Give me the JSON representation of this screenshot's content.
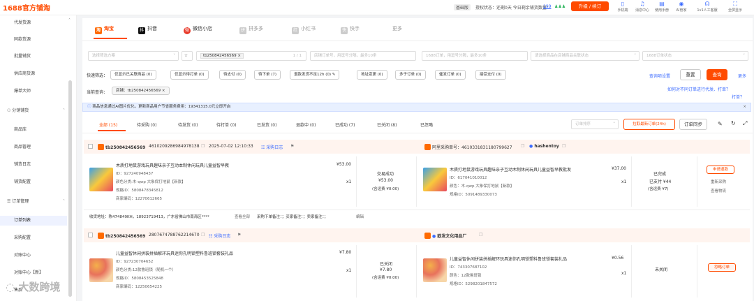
{
  "app": {
    "logo": "1688官方铺淘",
    "version": "基础版",
    "auth_status": "授权状态：还剩0天  今日剩余铺货数量：",
    "auth_count": "199",
    "upgrade": "升级 / 续订"
  },
  "top_icons": [
    "手机端",
    "消息中心",
    "使用手册",
    "AI管家",
    "1v1人工客服",
    "全屏显示"
  ],
  "sidebar": {
    "items": [
      {
        "label": "代发货源",
        "group": false
      },
      {
        "label": "同款货源",
        "group": false
      },
      {
        "label": "批量铺货",
        "group": false
      },
      {
        "label": "供应商货源",
        "group": false
      },
      {
        "label": "爆单大师",
        "group": false
      },
      {
        "label": "分销铺货",
        "group": true
      },
      {
        "label": "商品库",
        "group": false
      },
      {
        "label": "商品管理",
        "group": false
      },
      {
        "label": "铺货日志",
        "group": false
      },
      {
        "label": "铺货配置",
        "group": false
      },
      {
        "label": "订单管理",
        "group": true
      },
      {
        "label": "订单列表",
        "group": false
      },
      {
        "label": "采购配置",
        "group": false
      },
      {
        "label": "对账中心",
        "group": false
      },
      {
        "label": "对账中心【新】",
        "group": false
      },
      {
        "label": "售后",
        "group": false
      }
    ]
  },
  "platform_tabs": [
    {
      "label": "淘宝",
      "icon": "淘"
    },
    {
      "label": "抖音",
      "icon": "抖"
    },
    {
      "label": "微信小店",
      "icon": "微"
    },
    {
      "label": "拼多多",
      "icon": "拼"
    },
    {
      "label": "小红书",
      "icon": "红"
    },
    {
      "label": "快手",
      "icon": "快"
    },
    {
      "label": "更多",
      "icon": ""
    }
  ],
  "filters": {
    "scheme_placeholder": "选择筛选方案",
    "shop_tag": "tb250842456569",
    "shop_count": "1 / 1",
    "order_no_ph": "店铺订单号，用逗号分隔，最多10条",
    "ali_order_ph": "1688订单，用逗号分隔，最多10条",
    "buyer_ph": "请选择商品在店铺商品关联状态",
    "status_ph": "1688订单状态",
    "quick_label": "快速筛选：",
    "quick": [
      "仅显示已关联商品 (0)",
      "仅显示待打单 (0)",
      "待支付 (0)",
      "待下单 (7)",
      "退款发货不足12h (0)",
      "地址变更 (0)",
      "多子订单 (0)",
      "催发订单 (0)",
      "接受支付 (0)"
    ],
    "query_settings": "查询项设置",
    "reset": "重置",
    "search": "查询",
    "more": "更多",
    "current_label": "当前查询：",
    "current_tag": "店铺：tb250842456569",
    "help": "如何对不同订单进行代发、打单？"
  },
  "banner": "商品信息通过AI图片优化，更新商品用户节省服务费用：19341315.0元立即开启",
  "status_tabs": [
    "全部 (15)",
    "待采购 (0)",
    "待发货 (0)",
    "待打单 (0)",
    "已发货 (0)",
    "退款中 (0)",
    "已成功 (7)",
    "已关闭 (8)",
    "已忽略"
  ],
  "toolbar": {
    "sort": "订单排序",
    "fetch": "拉取最新订单(24h)",
    "sync": "订单同步"
  },
  "orders": [
    {
      "shop": "tb250842456569",
      "order_no": "4610209286984978138",
      "time": "2025-07-02 12:10:33",
      "log": "采购日志",
      "title": "木质打地鼠游戏玩具趣味亲子互动本制休闲玩具儿童益智早教",
      "id": "ID：927240948437",
      "sku": "颜色分类:木-qwp 大象保打地鼠【新款】",
      "spec": "规格ID：5808478345812",
      "code": "商家编码：12270612665",
      "price": "¥53.00",
      "qty": "x1",
      "trade_status": "交易成功",
      "trade_amount": "¥53.00",
      "trade_ship": "(含运费 ¥0.00)",
      "ali_label": "阿里采购单号：",
      "ali_no": "4610331831180799627",
      "supplier": "hashentoy",
      "ali_title": "木质打地鼠游戏玩具趣味亲子互动木制休闲玩具儿童益智早教批发",
      "ali_id": "ID：617041010012",
      "ali_sku": "颜色：木-qwp 大象保打地鼠【新款】",
      "ali_spec": "规格ID：5091489330073",
      "ali_price": "¥37.00",
      "ali_qty": "x1",
      "ali_status": "已完成",
      "ali_paid": "已支付 ¥44",
      "ali_ship": "(含运费 ¥7)",
      "actions": [
        "申请退款",
        "重新采购",
        "查看物流"
      ],
      "address_label": "收货地址：",
      "address": "陈474849KH，18923719413，广东省佛山市南海区****",
      "view_all": "查看全部",
      "remarks": "采购下单备注：；买家备注：；卖家备注：；",
      "edit": "编辑"
    },
    {
      "shop": "tb250842456569",
      "order_no": "2807674788762214670",
      "log": "采购日志",
      "title": "儿童益智休闲拼装拼插解环玩具迷你孔明锁塑料鲁班锁套装礼品",
      "id": "ID：927230704652",
      "sku": "颜色分类:12款鲁班锁（随机一个）",
      "spec": "规格ID：5808453525848",
      "code": "商家编码：12250654225",
      "price": "¥7.80",
      "qty": "x1",
      "trade_status": "已关闭",
      "trade_amount": "¥7.80",
      "trade_ship": "(含运费 ¥0.00)",
      "supplier": "欧发文化用品厂",
      "ali_title": "儿童益智休闲拼装拼插解环玩具迷你孔明锁塑料鲁班锁套装礼品",
      "ali_id": "ID：743307687102",
      "ali_sku": "颜色：12款鲁班锁",
      "ali_spec": "规格ID：5298201847572",
      "ali_price": "¥0.56",
      "ali_qty": "x1",
      "ali_status": "未关闭",
      "actions": [
        "忽略订单"
      ]
    }
  ],
  "watermark": "大数跨境",
  "colors": {
    "accent": "#ff4b00",
    "link": "#3b6bff",
    "banner_bg": "#e8f0ff"
  }
}
